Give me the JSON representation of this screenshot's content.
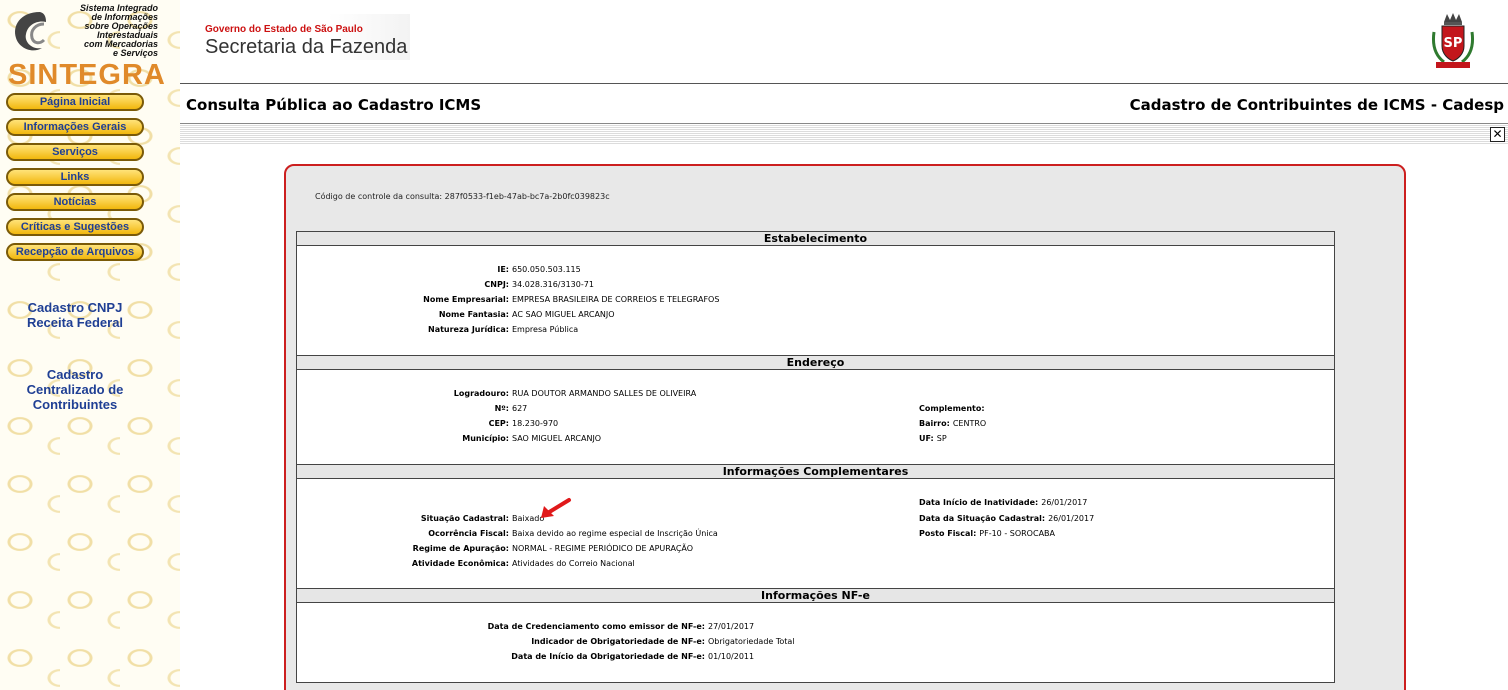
{
  "sidebar": {
    "logo_tagline": [
      "Sistema Integrado",
      "de Informações",
      "sobre Operações",
      "Interestaduais",
      "com Mercadorias",
      "e Serviços"
    ],
    "logo_word": "SINTEGRA",
    "menu": [
      "Página Inicial",
      "Informações Gerais",
      "Serviços",
      "Links",
      "Notícias",
      "Críticas e Sugestões",
      "Recepção de Arquivos"
    ],
    "link_cnpj": [
      "Cadastro CNPJ",
      "Receita Federal"
    ],
    "link_ccc": [
      "Cadastro",
      "Centralizado de",
      "Contribuintes"
    ]
  },
  "header": {
    "gov_line": "Governo do Estado de São Paulo",
    "gov_name": "Secretaria da Fazenda",
    "seal_text": "SP",
    "title_left": "Consulta Pública ao Cadastro ICMS",
    "title_right": "Cadastro de Contribuintes de ICMS - Cadesp",
    "close_glyph": "✕"
  },
  "control_code": "Código de controle da consulta: 287f0533-f1eb-47ab-bc7a-2b0fc039823c",
  "estabelecimento": {
    "title": "Estabelecimento",
    "fields": [
      {
        "label": "IE:",
        "value": "650.050.503.115"
      },
      {
        "label": "CNPJ:",
        "value": "34.028.316/3130-71"
      },
      {
        "label": "Nome Empresarial:",
        "value": "EMPRESA BRASILEIRA DE CORREIOS E TELEGRAFOS"
      },
      {
        "label": "Nome Fantasia:",
        "value": "AC SAO MIGUEL ARCANJO"
      },
      {
        "label": "Natureza Jurídica:",
        "value": "Empresa Pública"
      }
    ]
  },
  "endereco": {
    "title": "Endereço",
    "left": [
      {
        "label": "Logradouro:",
        "value": "RUA DOUTOR ARMANDO SALLES DE OLIVEIRA"
      },
      {
        "label": "Nº:",
        "value": "627"
      },
      {
        "label": "CEP:",
        "value": "18.230-970"
      },
      {
        "label": "Município:",
        "value": "SAO MIGUEL ARCANJO"
      }
    ],
    "right": [
      {
        "label": "Complemento:",
        "value": ""
      },
      {
        "label": "Bairro:",
        "value": "CENTRO"
      },
      {
        "label": "UF:",
        "value": "SP"
      }
    ]
  },
  "complementares": {
    "title": "Informações Complementares",
    "left": [
      {
        "label": "Situação Cadastral:",
        "value": "Baixado"
      },
      {
        "label": "Ocorrência Fiscal:",
        "value": "Baixa devido ao regime especial de Inscrição Única"
      },
      {
        "label": "Regime de Apuração:",
        "value": "NORMAL - REGIME PERIÓDICO DE APURAÇÃO"
      },
      {
        "label": "Atividade Econômica:",
        "value": "Atividades do Correio Nacional"
      }
    ],
    "right": [
      {
        "label": "Data Início de Inatividade:",
        "value": "26/01/2017"
      },
      {
        "label": "Data da Situação Cadastral:",
        "value": "26/01/2017"
      },
      {
        "label": "Posto Fiscal:",
        "value": "PF-10 - SOROCABA"
      }
    ]
  },
  "nfe": {
    "title": "Informações NF-e",
    "fields": [
      {
        "label": "Data de Credenciamento como emissor de NF-e:",
        "value": "27/01/2017"
      },
      {
        "label": "Indicador de Obrigatoriedade de NF-e:",
        "value": "Obrigatoriedade Total"
      },
      {
        "label": "Data de Início da Obrigatoriedade de NF-e:",
        "value": "01/10/2011"
      }
    ]
  },
  "colors": {
    "panel_border": "#cc1f1f",
    "nav_text": "#1f3f94",
    "button_fill": "#f2b70d",
    "annotation_arrow": "#e0191b"
  }
}
